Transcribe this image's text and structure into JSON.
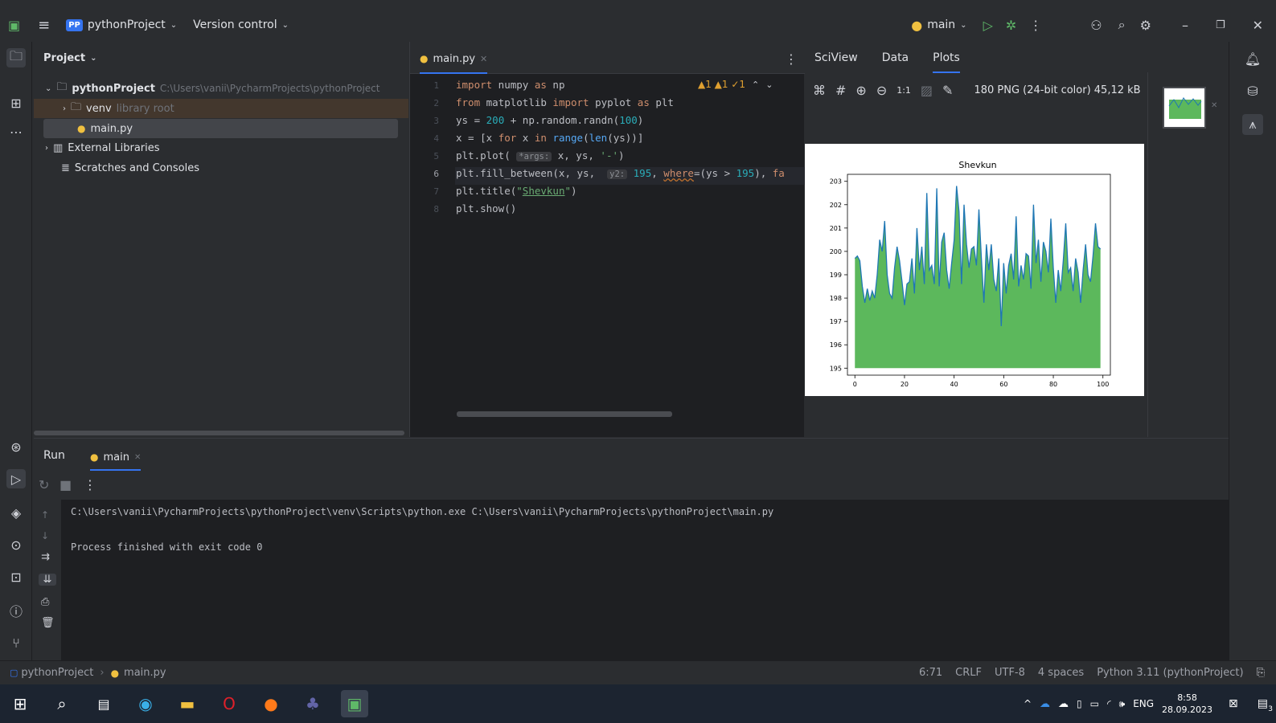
{
  "titlebar": {
    "project_badge": "PP",
    "project_name": "pythonProject",
    "version_control": "Version control",
    "run_config": "main"
  },
  "project_panel": {
    "title": "Project",
    "root_name": "pythonProject",
    "root_path": "C:\\Users\\vanii\\PycharmProjects\\pythonProject",
    "venv_name": "venv",
    "venv_note": "library root",
    "file": "main.py",
    "external": "External Libraries",
    "scratches": "Scratches and Consoles"
  },
  "editor": {
    "tab": "main.py",
    "inspection": "▲1 ▲1 ✓1",
    "lines": [
      "1",
      "2",
      "3",
      "4",
      "5",
      "6",
      "7",
      "8"
    ]
  },
  "sciview": {
    "tabs": [
      "SciView",
      "Data",
      "Plots"
    ],
    "zoom_label": "1:1",
    "image_info": "180 PNG (24-bit color) 45,12 kB"
  },
  "chart_data": {
    "type": "area",
    "title": "Shevkun",
    "ylim": [
      194.7,
      203.3
    ],
    "xlim": [
      -3,
      103
    ],
    "yticks": [
      195,
      196,
      197,
      198,
      199,
      200,
      201,
      202,
      203
    ],
    "xticks": [
      0,
      20,
      40,
      60,
      80,
      100
    ],
    "baseline": 195,
    "values": [
      199.7,
      199.8,
      199.6,
      198.5,
      197.8,
      198.4,
      197.9,
      198.3,
      198.0,
      199.0,
      200.5,
      200.0,
      201.3,
      199.0,
      198.2,
      198.0,
      199.3,
      200.2,
      199.6,
      198.7,
      197.7,
      198.6,
      198.7,
      199.7,
      198.2,
      201.0,
      199.2,
      200.2,
      198.6,
      202.5,
      199.2,
      199.4,
      198.6,
      202.7,
      198.5,
      200.4,
      200.8,
      199.2,
      198.4,
      199.5,
      200.5,
      202.8,
      201.7,
      198.6,
      202.0,
      200.3,
      199.3,
      200.1,
      200.2,
      199.4,
      201.8,
      199.7,
      197.8,
      200.3,
      199.2,
      200.3,
      198.8,
      198.3,
      199.7,
      196.8,
      199.5,
      198.2,
      199.4,
      199.9,
      198.8,
      201.5,
      198.5,
      199.4,
      198.8,
      199.9,
      199.8,
      198.4,
      202.0,
      199.5,
      200.5,
      198.7,
      200.4,
      200.0,
      199.1,
      201.4,
      199.3,
      197.8,
      199.2,
      198.3,
      199.6,
      201.2,
      199.1,
      199.3,
      198.3,
      199.7,
      199.1,
      197.8,
      199.2,
      200.3,
      199.0,
      198.7,
      199.8,
      201.2,
      200.2,
      200.1
    ]
  },
  "run": {
    "tab_run": "Run",
    "tab_main": "main",
    "cmd": "C:\\Users\\vanii\\PycharmProjects\\pythonProject\\venv\\Scripts\\python.exe C:\\Users\\vanii\\PycharmProjects\\pythonProject\\main.py",
    "result": "Process finished with exit code 0"
  },
  "status": {
    "crumb_project": "pythonProject",
    "crumb_file": "main.py",
    "position": "6:71",
    "line_sep": "CRLF",
    "encoding": "UTF-8",
    "indent": "4 spaces",
    "interpreter": "Python 3.11 (pythonProject)"
  },
  "taskbar": {
    "lang": "ENG",
    "time": "8:58",
    "date": "28.09.2023",
    "notif_count": "3"
  }
}
